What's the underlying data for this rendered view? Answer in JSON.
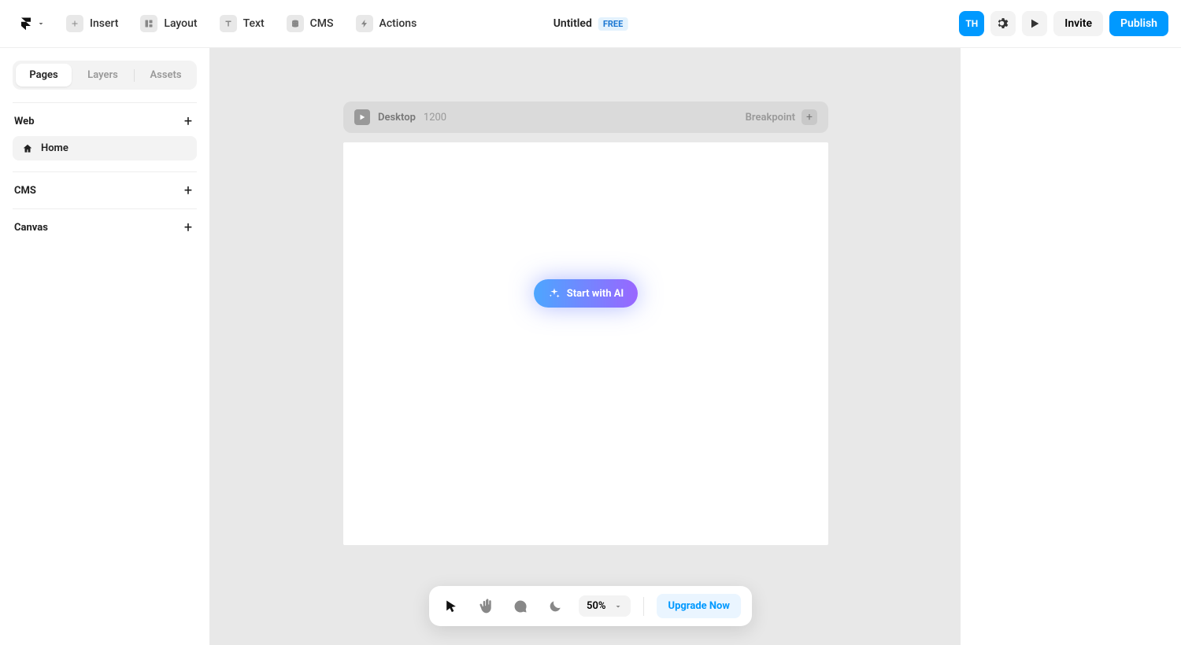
{
  "topbar": {
    "tools": {
      "insert": "Insert",
      "layout": "Layout",
      "text": "Text",
      "cms": "CMS",
      "actions": "Actions"
    },
    "title": "Untitled",
    "badge": "FREE",
    "avatar": "TH",
    "invite": "Invite",
    "publish": "Publish"
  },
  "sidebar": {
    "tabs": {
      "pages": "Pages",
      "layers": "Layers",
      "assets": "Assets"
    },
    "sections": {
      "web": {
        "title": "Web",
        "page": "Home"
      },
      "cms": {
        "title": "CMS"
      },
      "canvas": {
        "title": "Canvas"
      }
    }
  },
  "frame": {
    "device": "Desktop",
    "width": "1200",
    "breakpoint": "Breakpoint",
    "ai_button": "Start with AI"
  },
  "bottombar": {
    "zoom": "50%",
    "upgrade": "Upgrade Now"
  }
}
